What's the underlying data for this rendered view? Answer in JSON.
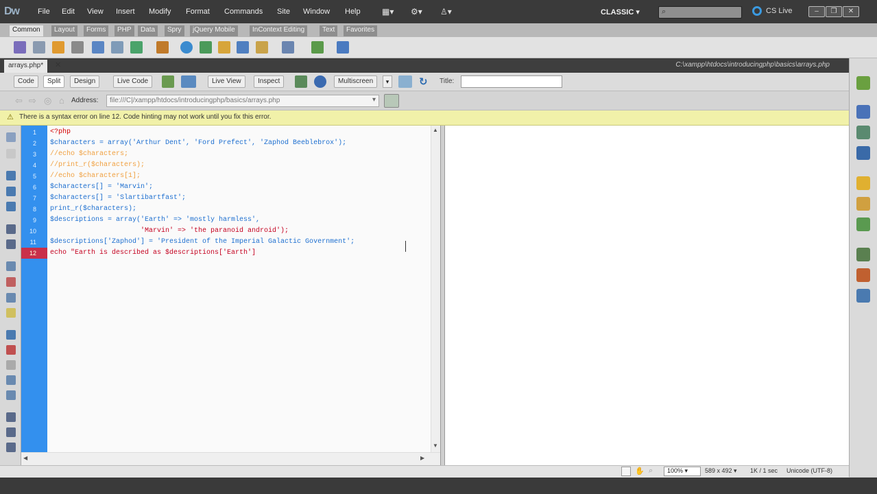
{
  "app": {
    "logo": "Dw"
  },
  "menubar": {
    "items": [
      "File",
      "Edit",
      "View",
      "Insert",
      "Modify",
      "Format",
      "Commands",
      "Site",
      "Window",
      "Help"
    ],
    "workspace": "CLASSIC ▾",
    "cslive": "CS Live"
  },
  "insert_tabs": [
    "Common",
    "Layout",
    "Forms",
    "PHP",
    "Data",
    "Spry",
    "jQuery Mobile",
    "InContext Editing",
    "Text",
    "Favorites"
  ],
  "document": {
    "tab_name": "arrays.php*",
    "path": "C:\\xampp\\htdocs\\introducingphp\\basics\\arrays.php"
  },
  "view_buttons": {
    "code": "Code",
    "split": "Split",
    "design": "Design",
    "live_code": "Live Code",
    "live_view": "Live View",
    "inspect": "Inspect",
    "multiscreen": "Multiscreen",
    "title_label": "Title:",
    "title_value": ""
  },
  "address": {
    "label": "Address:",
    "value": "file:///C|/xampp/htdocs/introducingphp/basics/arrays.php"
  },
  "warning": "There is a syntax error on line 12.  Code hinting may not work until you fix this error.",
  "code": {
    "line_numbers": [
      "1",
      "2",
      "3",
      "4",
      "5",
      "6",
      "7",
      "8",
      "9",
      "10",
      "11",
      "12"
    ],
    "error_line": "12",
    "lines": [
      "<?php",
      "$characters = array('Arthur Dent', 'Ford Prefect', 'Zaphod Beeblebrox');",
      "//echo $characters;",
      "//print_r($characters);",
      "//echo $characters[1];",
      "$characters[] = 'Marvin';",
      "$characters[] = 'Slartibartfast';",
      "print_r($characters);",
      "$descriptions = array('Earth' => 'mostly harmless',",
      "                      'Marvin' => 'the paranoid android');",
      "$descriptions['Zaphod'] = 'President of the Imperial Galactic Government';",
      "echo \"Earth is described as $descriptions['Earth']"
    ]
  },
  "status": {
    "zoom": "100% ▾",
    "dimensions": "589 x 492 ▾",
    "size": "1K / 1 sec",
    "encoding": "Unicode (UTF-8)"
  },
  "colors": {
    "gutter": "#3390ee",
    "error_line": "#c9304a",
    "warning_bg": "#f1f1a9",
    "menubar": "#3a3a3a"
  }
}
